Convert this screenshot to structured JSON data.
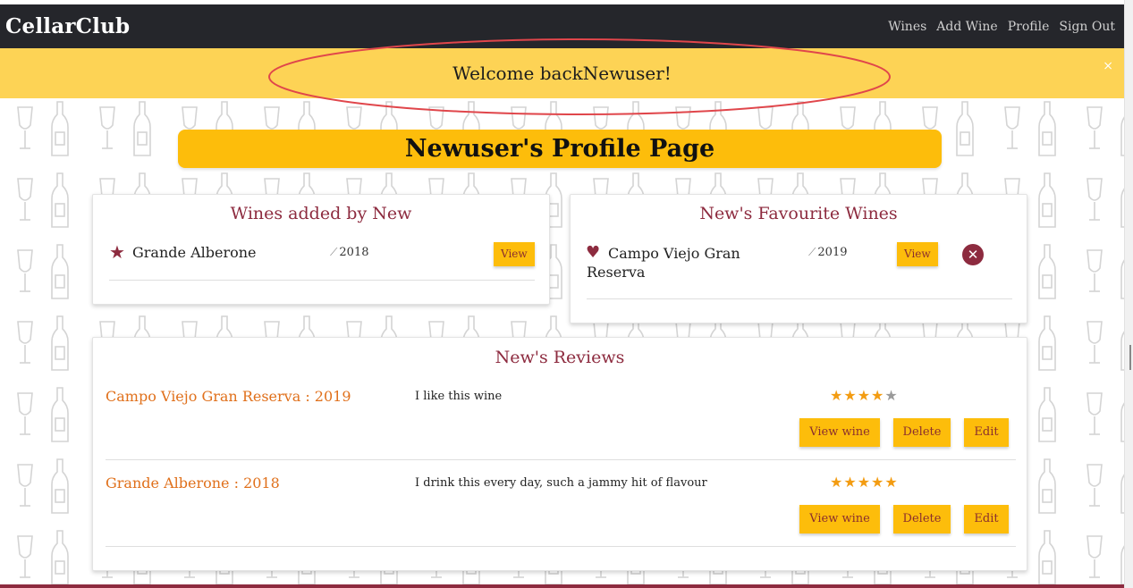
{
  "navbar": {
    "brand": "CellarClub",
    "links": [
      "Wines",
      "Add Wine",
      "Profile",
      "Sign Out"
    ]
  },
  "banner": {
    "message": "Welcome backNewuser!",
    "close_glyph": "×"
  },
  "profile": {
    "heading": "Newuser's Profile Page"
  },
  "added_wines": {
    "title": "Wines added by New",
    "items": [
      {
        "name": "Grande Alberone",
        "vintage": "2018",
        "view_label": "View"
      }
    ]
  },
  "favourite_wines": {
    "title": "New's Favourite Wines",
    "items": [
      {
        "name": "Campo Viejo Gran Reserva",
        "vintage": "2019",
        "view_label": "View"
      }
    ]
  },
  "reviews": {
    "title": "New's Reviews",
    "items": [
      {
        "wine": "Campo Viejo Gran Reserva : 2019",
        "text": "I like this wine",
        "rating": 4,
        "max_rating": 5,
        "view_label": "View wine",
        "delete_label": "Delete",
        "edit_label": "Edit"
      },
      {
        "wine": "Grande Alberone : 2018",
        "text": "I drink this every day, such a jammy hit of flavour",
        "rating": 5,
        "max_rating": 5,
        "view_label": "View wine",
        "delete_label": "Delete",
        "edit_label": "Edit"
      }
    ]
  },
  "colors": {
    "navbar": "#25262b",
    "banner": "#fdd355",
    "accent": "#fdbd0b",
    "wine_red": "#8d2b3f",
    "review_link": "#e0701b",
    "star": "#f39c12"
  }
}
